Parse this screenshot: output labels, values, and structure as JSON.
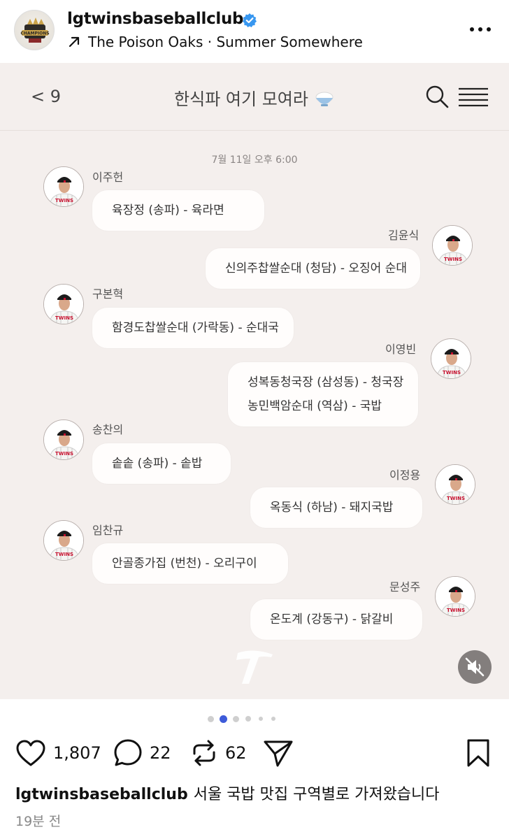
{
  "post": {
    "username": "lgtwinsbaseballclub",
    "music": "The Poison Oaks · Summer Somewhere",
    "avatar_badge_text": "CHAMPIONS"
  },
  "chat": {
    "back_label": "< 9",
    "room_title": "한식파 여기 모여라",
    "date": "7월 11일 오후 6:00",
    "messages": [
      {
        "name": "이주헌",
        "text": "육장정 (송파) - 육라면"
      },
      {
        "name": "김윤식",
        "text": "신의주찹쌀순대 (청담) - 오징어 순대"
      },
      {
        "name": "구본혁",
        "text": "함경도찹쌀순대 (가락동) - 순대국"
      },
      {
        "name": "이영빈",
        "text": "성복동청국장 (삼성동) - 청국장",
        "text2": "농민백암순대 (역삼) - 국밥"
      },
      {
        "name": "송찬의",
        "text": "솥솥 (송파) - 솥밥"
      },
      {
        "name": "이정용",
        "text": "옥동식 (하남) - 돼지국밥"
      },
      {
        "name": "임찬규",
        "text": "안골종가집 (번천) - 오리구이"
      },
      {
        "name": "문성주",
        "text": "온도계 (강동구) - 닭갈비"
      }
    ],
    "jersey_text": "TWINS"
  },
  "carousel": {
    "current": 2,
    "total": 6
  },
  "actions": {
    "likes": "1,807",
    "comments": "22",
    "reposts": "62"
  },
  "caption": {
    "user": "lgtwinsbaseballclub",
    "text": "서울 국밥 맛집 구역별로 가져왔습니다"
  },
  "timestamp": "19분 전",
  "colors": {
    "verified": "#3897f0",
    "bubble": "#fffdfc",
    "chat_bg": "#f4efed",
    "active_dot": "#3d5bd9",
    "jersey_red": "#c8102e"
  }
}
